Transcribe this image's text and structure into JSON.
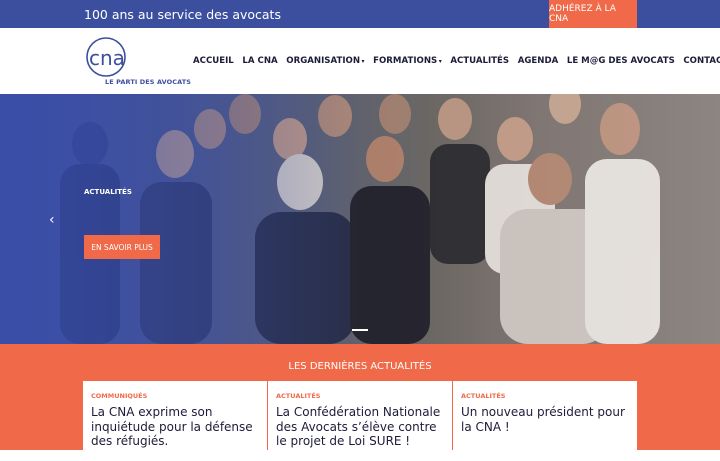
{
  "topbar": {
    "tagline": "100 ans au service des avocats",
    "join_label": "ADHÉREZ À LA CNA"
  },
  "logo": {
    "wordmark": "cna",
    "baseline": "LE PARTI DES AVOCATS"
  },
  "nav": {
    "items": [
      {
        "label": "ACCUEIL",
        "has_dropdown": false
      },
      {
        "label": "LA CNA",
        "has_dropdown": false
      },
      {
        "label": "ORGANISATION",
        "has_dropdown": true
      },
      {
        "label": "FORMATIONS",
        "has_dropdown": true
      },
      {
        "label": "ACTUALITÉS",
        "has_dropdown": false
      },
      {
        "label": "AGENDA",
        "has_dropdown": false
      },
      {
        "label": "LE M@G DES AVOCATS",
        "has_dropdown": false
      },
      {
        "label": "CONTACT",
        "has_dropdown": false
      }
    ]
  },
  "hero": {
    "label": "ACTUALITÉS",
    "button_label": "EN SAVOIR PLUS",
    "prev_glyph": "‹"
  },
  "news": {
    "title": "LES DERNIÈRES ACTUALITÉS",
    "cards": [
      {
        "category": "COMMUNIQUÉS",
        "headline": "La CNA exprime son inquiétude pour la défense des réfugiés."
      },
      {
        "category": "ACTUALITÉS",
        "headline": "La Confédération Nationale des Avocats s’élève contre le projet de Loi SURE !"
      },
      {
        "category": "ACTUALITÉS",
        "headline": "Un nouveau président pour la CNA !"
      }
    ]
  },
  "colors": {
    "brand_blue": "#3c4f9f",
    "accent_orange": "#f06a4a",
    "text_dark": "#1c1c3a"
  }
}
